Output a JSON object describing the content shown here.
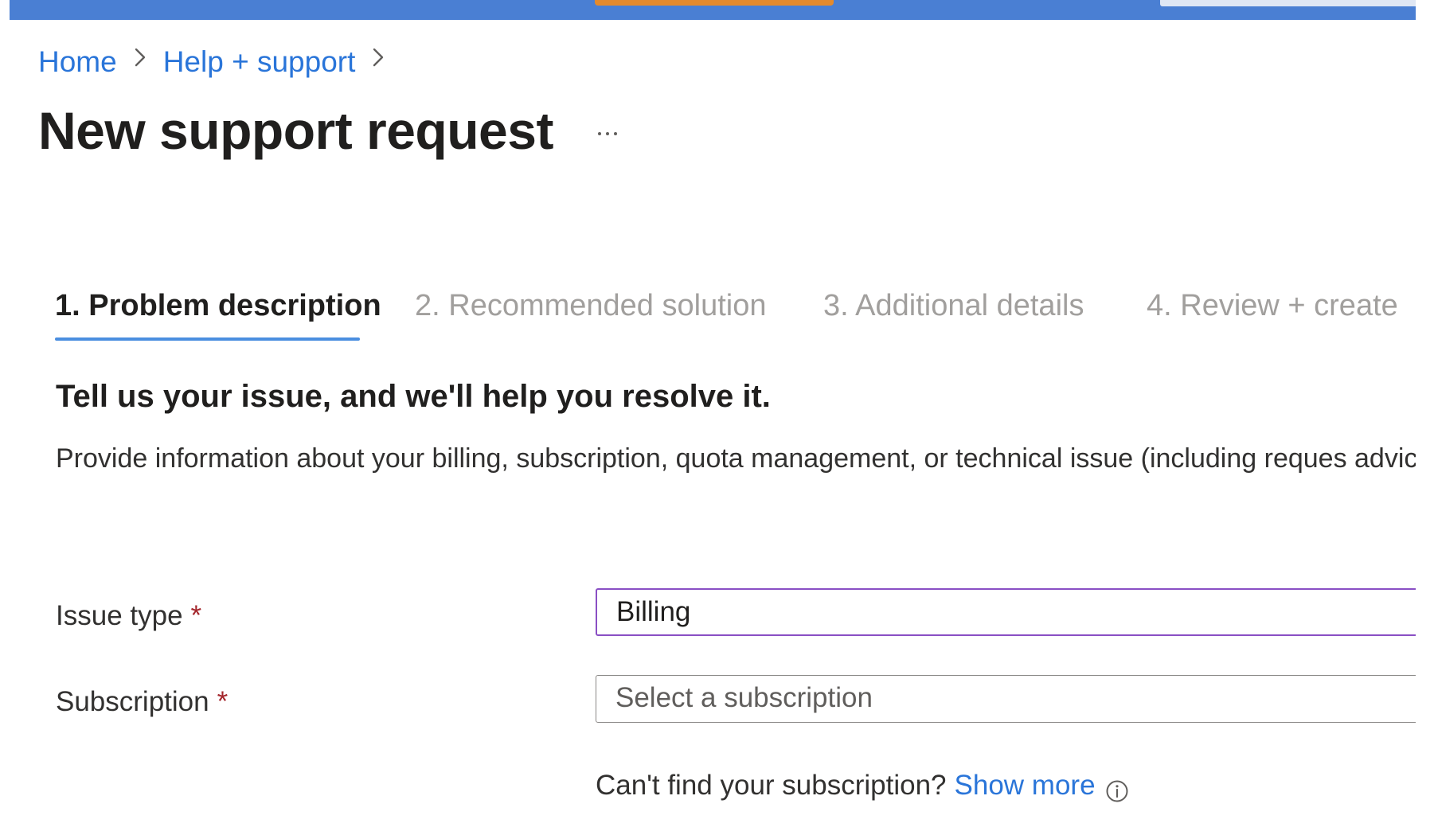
{
  "breadcrumb": {
    "items": [
      {
        "label": "Home"
      },
      {
        "label": "Help + support"
      }
    ]
  },
  "page": {
    "title": "New support request",
    "more_label": "More options"
  },
  "tabs": [
    {
      "label": "1. Problem description",
      "active": true
    },
    {
      "label": "2. Recommended solution",
      "active": false
    },
    {
      "label": "3. Additional details",
      "active": false
    },
    {
      "label": "4. Review + create",
      "active": false
    }
  ],
  "section": {
    "heading": "Tell us your issue, and we'll help you resolve it.",
    "description": "Provide information about your billing, subscription, quota management, or technical issue (including reques advice)."
  },
  "form": {
    "issue_type": {
      "label": "Issue type",
      "required_mark": "*",
      "value": "Billing"
    },
    "subscription": {
      "label": "Subscription",
      "required_mark": "*",
      "placeholder": "Select a subscription"
    },
    "help": {
      "text": "Can't find your subscription?",
      "link": "Show more"
    }
  },
  "colors": {
    "top_bar": "#4a7fd3",
    "link": "#2a75d9",
    "active_tab_underline": "#4a8ee0",
    "selected_field_border": "#8a4fc4",
    "required": "#a4262c"
  },
  "icons": {
    "breadcrumb_separator": "chevron-right-icon",
    "more": "ellipsis-icon",
    "info": "info-icon"
  }
}
